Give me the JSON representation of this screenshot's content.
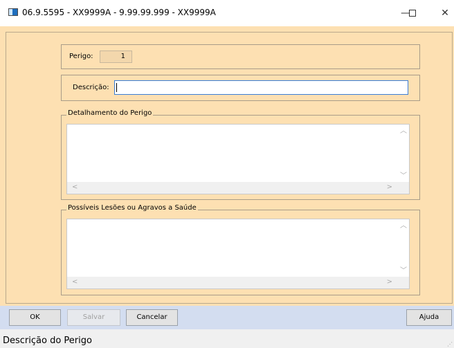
{
  "window": {
    "title": "06.9.5595 - XX9999A - 9.99.99.999 - XX9999A",
    "minimize_glyph": "—",
    "maximize_glyph": "☐",
    "close_glyph": "✕"
  },
  "form": {
    "perigo_label": "Perigo:",
    "perigo_value": "1",
    "descricao_label": "Descrição:",
    "descricao_value": "",
    "detalhamento_legend": "Detalhamento do Perigo",
    "detalhamento_value": "",
    "lesoes_legend": "Possíveis Lesões ou Agravos a Saúde",
    "lesoes_value": ""
  },
  "buttons": {
    "ok": "OK",
    "salvar": "Salvar",
    "cancelar": "Cancelar",
    "ajuda": "Ajuda"
  },
  "status": {
    "text": "Descrição do Perigo"
  },
  "colors": {
    "form_background": "#fde0b2",
    "button_bar": "#d3ddf0",
    "input_focus_border": "#3a7dd6"
  }
}
